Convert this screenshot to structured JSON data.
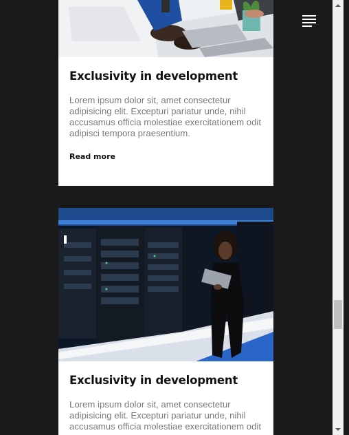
{
  "colors": {
    "background": "#1a1a1a",
    "card": "#ffffff",
    "title": "#111111",
    "body_text": "#7a7a7a"
  },
  "header": {
    "menu_icon": "hamburger-menu-icon"
  },
  "cards": [
    {
      "title": "Exclusivity in development",
      "text": "Lorem ipsum dolor sit, amet consectetur adipisicing elit. Excepturi pariatur unde, nihil accusamus officia molestiae exercitationem odit adipisci tempora praesentium.",
      "link": "Read more",
      "image_alt": "team-meeting-photo"
    },
    {
      "title": "Exclusivity in development",
      "text": "Lorem ipsum dolor sit, amet consectetur adipisicing elit. Excepturi pariatur unde, nihil accusamus officia molestiae exercitationem odit",
      "image_alt": "server-room-photo"
    }
  ]
}
